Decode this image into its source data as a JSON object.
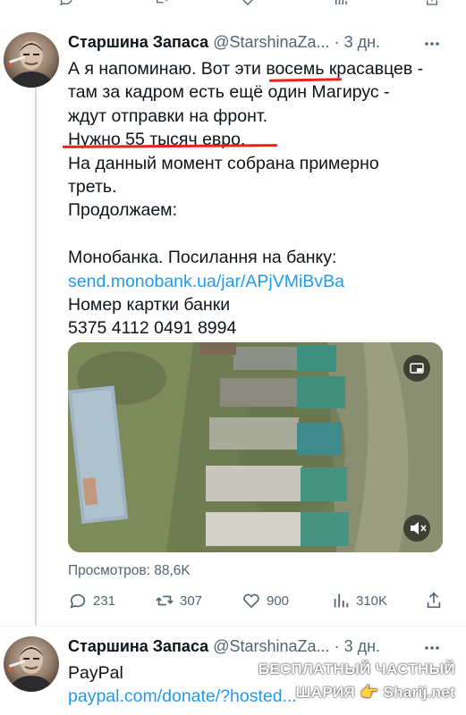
{
  "tweet1": {
    "display_name": "Старшина Запаса",
    "handle": "@StarshinaZa...",
    "separator": "·",
    "time": "3 дн.",
    "lines": [
      {
        "t": "А я напоминаю. Вот эти восемь красавцев -"
      },
      {
        "t": "там за кадром есть ещё один Магирус -"
      },
      {
        "t": "ждут отправки на фронт."
      },
      {
        "t": "Нужно 55 тысяч евро."
      },
      {
        "t": "На данный момент собрана примерно"
      },
      {
        "t": "треть."
      },
      {
        "t": "Продолжаем:"
      },
      {
        "t": ""
      },
      {
        "t": "Монобанка. Посилання на банку:"
      },
      {
        "t": "send.monobank.ua/jar/APjVMiBvBa",
        "link": true
      },
      {
        "t": "Номер картки банки"
      },
      {
        "t": "5375 4112 0491 8994"
      }
    ],
    "views_label": "Просмотров: 88,6K",
    "actions": {
      "replies": "231",
      "retweets": "307",
      "likes": "900",
      "views": "310K"
    }
  },
  "tweet2": {
    "display_name": "Старшина Запаса",
    "handle": "@StarshinaZa...",
    "separator": "·",
    "time": "3 дн.",
    "text": "PayPal",
    "link": "paypal.com/donate/?hosted..."
  },
  "watermark": {
    "line1": "БЕСПЛАТНЫЙ ЧАСТНЫЙ",
    "line2": "ШАРИЯ 👉 Sharij.net"
  },
  "colors": {
    "link": "#1d9bf0",
    "underline": "#e8231c",
    "secondary_text": "#536471"
  }
}
